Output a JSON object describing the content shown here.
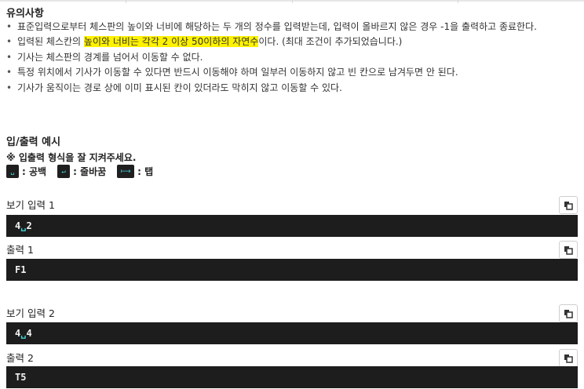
{
  "notes": {
    "title": "유의사항",
    "items": [
      {
        "text": "표준입력으로부터 체스판의 높이와 너비에 해당하는 두 개의 정수를 입력받는데, 입력이 올바르지 않은 경우 -1을 출력하고 종료한다."
      },
      {
        "before": "입력된 체스칸의 ",
        "highlight": "높이와 너비는 각각 2 이상 50이하의 자연수",
        "after": "이다. (최대 조건이 추가되었습니다.)"
      },
      {
        "text": "기사는 체스판의 경계를 넘어서 이동할 수 없다."
      },
      {
        "text": "특정 위치에서 기사가 이동할 수 있다면 반드시 이동해야 하며 일부러 이동하지 않고 빈 칸으로 남겨두면 안 된다."
      },
      {
        "text": "기사가 움직이는 경로 상에 이미 표시된 칸이 있더라도 막히지 않고 이동할 수 있다."
      }
    ]
  },
  "io": {
    "title": "입/출력 예시",
    "legend_heading": "※ 입출력 형식을 잘 지켜주세요.",
    "legend": [
      {
        "symbol": "␣",
        "label": ": 공백",
        "icon": "space-key-icon"
      },
      {
        "symbol": "↵",
        "label": ": 줄바꿈",
        "icon": "newline-key-icon"
      },
      {
        "symbol": "⟼",
        "label": ": 탭",
        "icon": "tab-key-icon"
      }
    ],
    "examples": [
      {
        "input_label": "보기 입력 1",
        "input": [
          "4",
          "␣",
          "2"
        ],
        "output_label": "출력 1",
        "output": "F1"
      },
      {
        "input_label": "보기 입력 2",
        "input": [
          "4",
          "␣",
          "4"
        ],
        "output_label": "출력 2",
        "output": "T5"
      }
    ]
  },
  "icons": {
    "copy": "copy-icon"
  }
}
